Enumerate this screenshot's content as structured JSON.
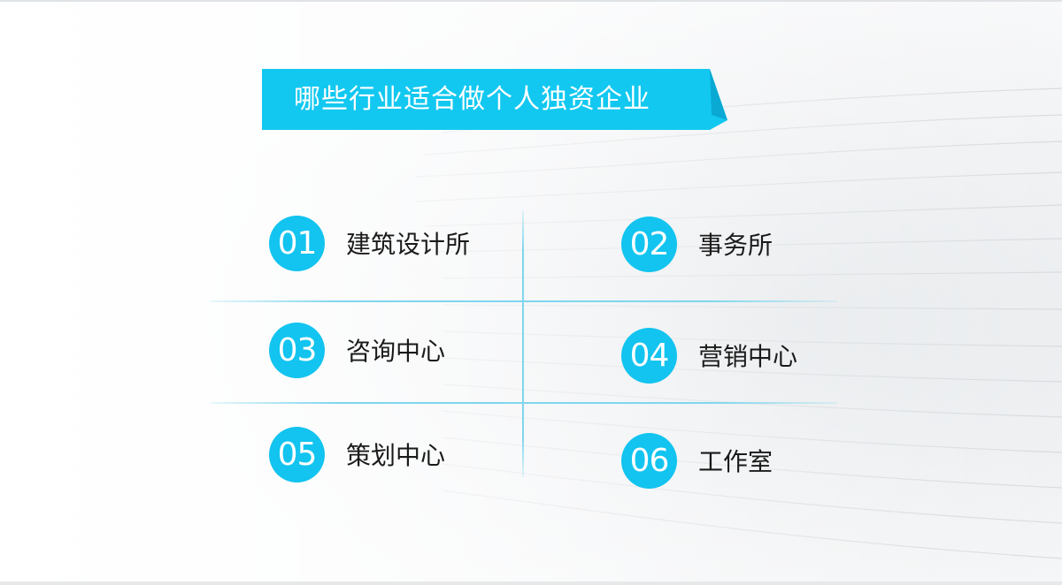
{
  "title": "哪些行业适合做个人独资企业",
  "colors": {
    "accent": "#12c4ef",
    "banner": "#12c8f0",
    "line": "#7fd6ee",
    "text": "#1a1a1a"
  },
  "items": [
    {
      "number": "01",
      "label": "建筑设计所"
    },
    {
      "number": "02",
      "label": "事务所"
    },
    {
      "number": "03",
      "label": "咨询中心"
    },
    {
      "number": "04",
      "label": "营销中心"
    },
    {
      "number": "05",
      "label": "策划中心"
    },
    {
      "number": "06",
      "label": "工作室"
    }
  ]
}
